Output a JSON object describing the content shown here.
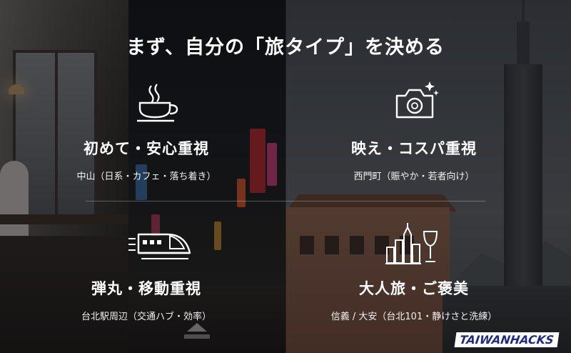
{
  "title": "まず、自分の「旅タイプ」を決める",
  "quadrants": [
    {
      "icon": "coffee-cup-icon",
      "label": "初めて・安心重視",
      "sub": "中山（日系・カフェ・落ち着き）"
    },
    {
      "icon": "camera-icon",
      "label": "映え・コスパ重視",
      "sub": "西門町（賑やか・若者向け）"
    },
    {
      "icon": "bullet-train-icon",
      "label": "弾丸・移動重視",
      "sub": "台北駅周辺（交通ハブ・効率）"
    },
    {
      "icon": "city-wine-icon",
      "label": "大人旅・ご褒美",
      "sub": "信義 / 大安（台北101・静けさと洗練）"
    }
  ],
  "watermark": "TAIWANHACKS",
  "colors": {
    "text": "#ffffff",
    "overlay": "#0f0f12",
    "watermark": "#1f2a8a"
  }
}
